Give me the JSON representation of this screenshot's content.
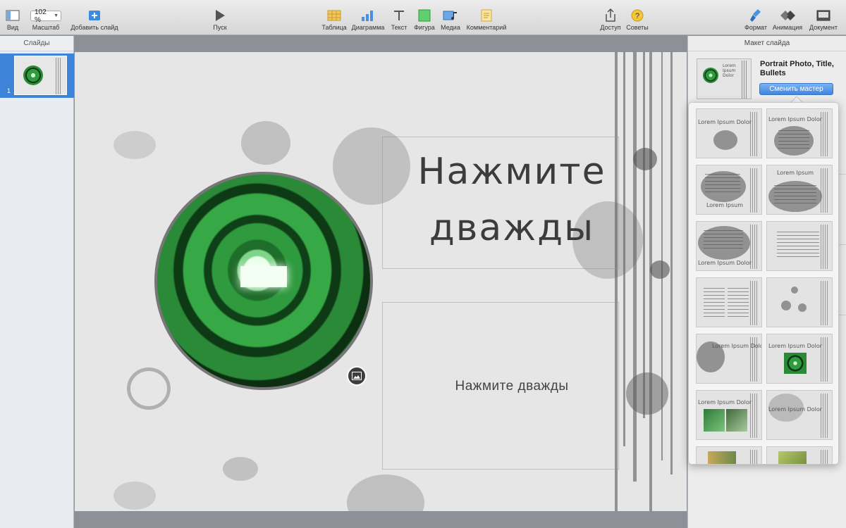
{
  "toolbar": {
    "left": [
      {
        "label": "Вид",
        "icon": "view-icon"
      },
      {
        "label": "Масштаб",
        "value": "102 %",
        "icon": "zoom-dropdown"
      },
      {
        "label": "Добавить слайд",
        "icon": "add-slide-icon"
      }
    ],
    "play": {
      "label": "Пуск",
      "icon": "play-icon"
    },
    "insert": [
      {
        "label": "Таблица",
        "icon": "table-icon"
      },
      {
        "label": "Диаграмма",
        "icon": "chart-icon"
      },
      {
        "label": "Текст",
        "icon": "text-icon"
      },
      {
        "label": "Фигура",
        "icon": "shape-icon"
      },
      {
        "label": "Медиа",
        "icon": "media-icon"
      },
      {
        "label": "Комментарий",
        "icon": "comment-icon"
      }
    ],
    "share": [
      {
        "label": "Доступ",
        "icon": "share-icon"
      },
      {
        "label": "Советы",
        "icon": "tips-icon"
      }
    ],
    "inspectors": [
      {
        "label": "Формат",
        "icon": "format-brush-icon"
      },
      {
        "label": "Анимация",
        "icon": "animate-icon"
      },
      {
        "label": "Документ",
        "icon": "document-icon"
      }
    ]
  },
  "slides_panel": {
    "header": "Слайды",
    "slides": [
      {
        "number": "1"
      }
    ]
  },
  "slide": {
    "title": "Нажмите дважды",
    "subtitle": "Нажмите  дважды"
  },
  "inspector": {
    "header": "Макет слайда",
    "master_name": "Portrait Photo, Title, Bullets",
    "change_master_button": "Сменить мастер",
    "thumb_title": "Lorem Ipsum Dolor"
  },
  "masters": [
    {
      "title": "Lorem Ipsum Dolor"
    },
    {
      "title": "Lorem Ipsum Dolor"
    },
    {
      "title": "Lorem Ipsum"
    },
    {
      "title": "Lorem Ipsum"
    },
    {
      "title": "Lorem Ipsum Dolor"
    },
    {
      "title": ""
    },
    {
      "title": ""
    },
    {
      "title": ""
    },
    {
      "title": "Lorem Ipsum Dolor"
    },
    {
      "title": "Lorem Ipsum Dolor"
    },
    {
      "title": "Lorem Ipsum Dolor"
    },
    {
      "title": "Lorem Ipsum Dolor"
    },
    {
      "title": ""
    },
    {
      "title": ""
    }
  ],
  "colors": {
    "accent": "#3f86e2",
    "selection": "#3d83d8",
    "photo_green": "#2f9a3e"
  }
}
